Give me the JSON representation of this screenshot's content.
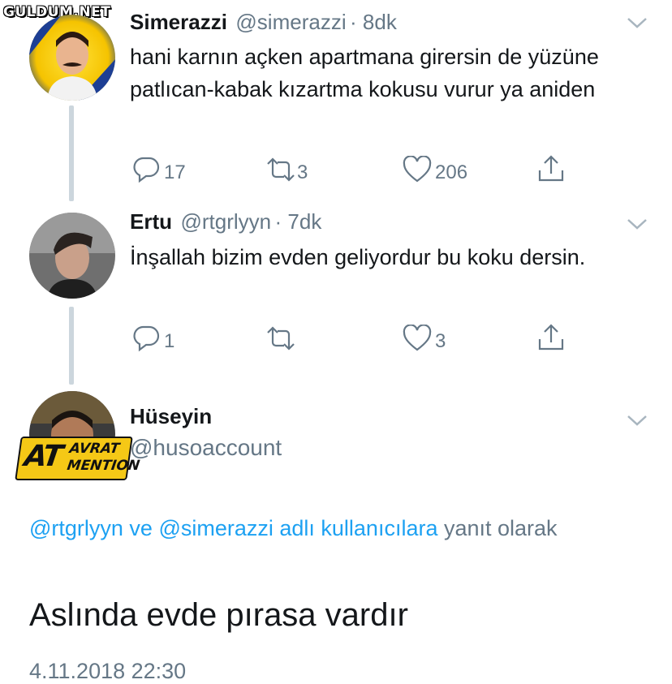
{
  "watermark": "GULDUM.NET",
  "tweets": [
    {
      "name": "Simerazzi",
      "handle": "@simerazzi",
      "time": "· 8dk",
      "text": "hani karnın açken apartmana girersin de yüzüne patlıcan-kabak kızartma kokusu vurur ya aniden",
      "replies": "17",
      "retweets": "3",
      "likes": "206"
    },
    {
      "name": "Ertu",
      "handle": "@rtgrlyyn",
      "time": "· 7dk",
      "text": "İnşallah bizim evden geliyordur bu koku dersin.",
      "replies": "1",
      "retweets": "",
      "likes": "3"
    }
  ],
  "main_tweet": {
    "name": "Hüseyin",
    "handle": "@husoaccount",
    "badge": {
      "at": "AT",
      "avrat": "AVRAT",
      "mention": "MENTION"
    },
    "replying_mentions": "@rtgrlyyn ve @simerazzi adlı kullanıcılara",
    "replying_suffix": "yanıt olarak",
    "text": "Aslında evde pırasa vardır",
    "date": "4.11.2018 22:30"
  },
  "colors": {
    "link": "#1da1f2",
    "muted": "#657786",
    "thread_line": "#ccd6dd",
    "badge": "#f5c816"
  },
  "icons": [
    "reply-icon",
    "retweet-icon",
    "like-icon",
    "share-icon",
    "chevron-down-icon"
  ]
}
